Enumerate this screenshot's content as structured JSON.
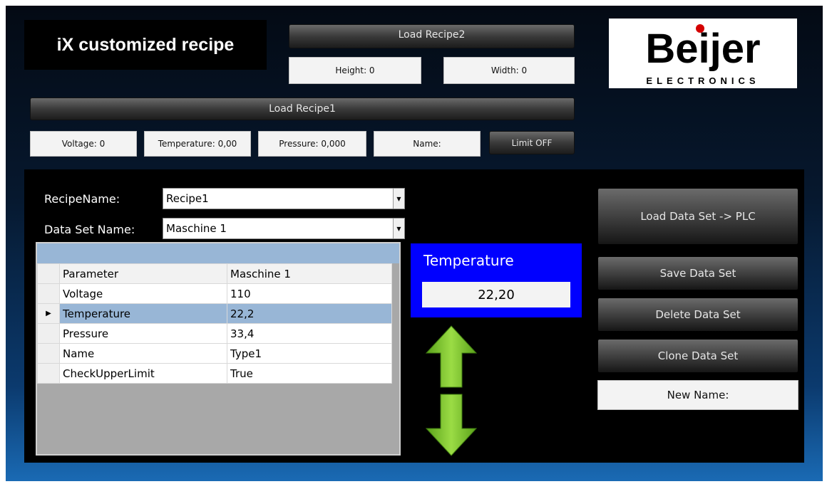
{
  "header": {
    "title": "iX customized recipe",
    "load_recipe2": "Load Recipe2",
    "height": "Height: 0",
    "width": "Width: 0",
    "load_recipe1": "Load Recipe1"
  },
  "logo": {
    "name": "Beijer",
    "sub": "ELECTRONICS",
    "dot_color": "#d40000"
  },
  "status": {
    "voltage": "Voltage: 0",
    "temperature": "Temperature:  0,00",
    "pressure": "Pressure: 0,000",
    "name": "Name:",
    "limit": "Limit OFF"
  },
  "recipe": {
    "recipe_name_label": "RecipeName:",
    "recipe_name_value": "Recipe1",
    "dataset_label": "Data Set Name:",
    "dataset_value": "Maschine 1"
  },
  "grid": {
    "columns": [
      "Parameter",
      "Maschine 1"
    ],
    "rows": [
      {
        "param": "Voltage",
        "value": "110"
      },
      {
        "param": "Temperature",
        "value": "22,2"
      },
      {
        "param": "Pressure",
        "value": "33,4"
      },
      {
        "param": "Name",
        "value": "Type1"
      },
      {
        "param": "CheckUpperLimit",
        "value": "True"
      }
    ],
    "selected_row": 1
  },
  "temperature_panel": {
    "title": "Temperature",
    "value": "22,20"
  },
  "actions": {
    "load_plc": "Load Data Set -> PLC",
    "save": "Save Data Set",
    "delete": "Delete Data Set",
    "clone": "Clone Data Set",
    "new_name": "New Name:"
  },
  "colors": {
    "panel_blue": "#0000ff",
    "arrow_green": "#7bc428",
    "selection": "#98b6d6"
  },
  "icons": {
    "up": "arrow-up-icon",
    "down": "arrow-down-icon"
  }
}
